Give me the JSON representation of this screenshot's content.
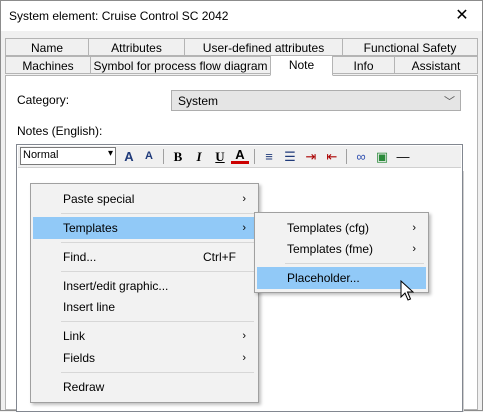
{
  "window": {
    "title": "System element: Cruise Control SC 2042",
    "close_glyph": "✕"
  },
  "tabs_row1": [
    "Name",
    "Attributes",
    "User-defined attributes",
    "Functional Safety"
  ],
  "tabs_row2": [
    "Machines",
    "Symbol for process flow diagram",
    "Note",
    "Info",
    "Assistant"
  ],
  "category": {
    "label": "Category:",
    "value": "System"
  },
  "notes_label": "Notes (English):",
  "toolbar": {
    "font_value": "Normal",
    "buttons": [
      {
        "icon": "font-grow-icon",
        "glyph": "A"
      },
      {
        "icon": "font-shrink-icon",
        "glyph": "A"
      },
      {
        "icon": "bold-icon",
        "glyph": "B"
      },
      {
        "icon": "italic-icon",
        "glyph": "I"
      },
      {
        "icon": "underline-icon",
        "glyph": "U"
      },
      {
        "icon": "text-color-icon",
        "glyph": "A"
      },
      {
        "icon": "numbered-list-icon",
        "glyph": "≡"
      },
      {
        "icon": "bullet-list-icon",
        "glyph": "☰"
      },
      {
        "icon": "indent-icon",
        "glyph": "⇥"
      },
      {
        "icon": "outdent-icon",
        "glyph": "⇤"
      },
      {
        "icon": "link-icon",
        "glyph": "∞"
      },
      {
        "icon": "image-icon",
        "glyph": "▣"
      },
      {
        "icon": "horizontal-rule-icon",
        "glyph": "—"
      }
    ]
  },
  "context_menu": {
    "items": [
      {
        "label": "Paste special",
        "submenu": true,
        "shortcut": ""
      },
      {
        "label": "Templates",
        "submenu": true,
        "shortcut": "",
        "highlighted": true
      },
      {
        "label": "Find...",
        "submenu": false,
        "shortcut": "Ctrl+F"
      },
      {
        "label": "Insert/edit graphic...",
        "submenu": false,
        "shortcut": ""
      },
      {
        "label": "Insert line",
        "submenu": false,
        "shortcut": ""
      },
      {
        "label": "Link",
        "submenu": true,
        "shortcut": ""
      },
      {
        "label": "Fields",
        "submenu": true,
        "shortcut": ""
      },
      {
        "label": "Redraw",
        "submenu": false,
        "shortcut": ""
      }
    ],
    "submenu_glyph": "›"
  },
  "templates_submenu": {
    "items": [
      {
        "label": "Templates (cfg)",
        "submenu": true
      },
      {
        "label": "Templates (fme)",
        "submenu": true
      },
      {
        "label": "Placeholder...",
        "submenu": false,
        "highlighted": true
      }
    ]
  }
}
